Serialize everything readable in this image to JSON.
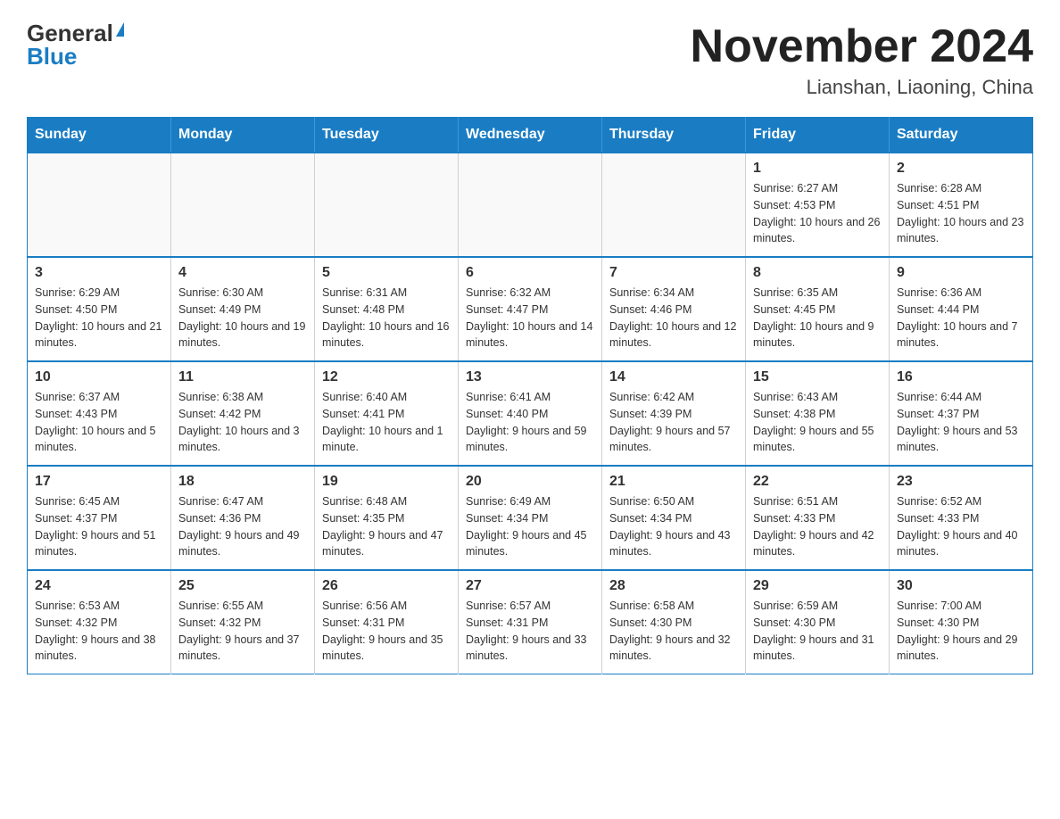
{
  "logo": {
    "general": "General",
    "blue": "Blue",
    "triangle": "▶"
  },
  "header": {
    "month_year": "November 2024",
    "location": "Lianshan, Liaoning, China"
  },
  "weekdays": [
    "Sunday",
    "Monday",
    "Tuesday",
    "Wednesday",
    "Thursday",
    "Friday",
    "Saturday"
  ],
  "weeks": [
    [
      {
        "day": "",
        "info": ""
      },
      {
        "day": "",
        "info": ""
      },
      {
        "day": "",
        "info": ""
      },
      {
        "day": "",
        "info": ""
      },
      {
        "day": "",
        "info": ""
      },
      {
        "day": "1",
        "info": "Sunrise: 6:27 AM\nSunset: 4:53 PM\nDaylight: 10 hours and 26 minutes."
      },
      {
        "day": "2",
        "info": "Sunrise: 6:28 AM\nSunset: 4:51 PM\nDaylight: 10 hours and 23 minutes."
      }
    ],
    [
      {
        "day": "3",
        "info": "Sunrise: 6:29 AM\nSunset: 4:50 PM\nDaylight: 10 hours and 21 minutes."
      },
      {
        "day": "4",
        "info": "Sunrise: 6:30 AM\nSunset: 4:49 PM\nDaylight: 10 hours and 19 minutes."
      },
      {
        "day": "5",
        "info": "Sunrise: 6:31 AM\nSunset: 4:48 PM\nDaylight: 10 hours and 16 minutes."
      },
      {
        "day": "6",
        "info": "Sunrise: 6:32 AM\nSunset: 4:47 PM\nDaylight: 10 hours and 14 minutes."
      },
      {
        "day": "7",
        "info": "Sunrise: 6:34 AM\nSunset: 4:46 PM\nDaylight: 10 hours and 12 minutes."
      },
      {
        "day": "8",
        "info": "Sunrise: 6:35 AM\nSunset: 4:45 PM\nDaylight: 10 hours and 9 minutes."
      },
      {
        "day": "9",
        "info": "Sunrise: 6:36 AM\nSunset: 4:44 PM\nDaylight: 10 hours and 7 minutes."
      }
    ],
    [
      {
        "day": "10",
        "info": "Sunrise: 6:37 AM\nSunset: 4:43 PM\nDaylight: 10 hours and 5 minutes."
      },
      {
        "day": "11",
        "info": "Sunrise: 6:38 AM\nSunset: 4:42 PM\nDaylight: 10 hours and 3 minutes."
      },
      {
        "day": "12",
        "info": "Sunrise: 6:40 AM\nSunset: 4:41 PM\nDaylight: 10 hours and 1 minute."
      },
      {
        "day": "13",
        "info": "Sunrise: 6:41 AM\nSunset: 4:40 PM\nDaylight: 9 hours and 59 minutes."
      },
      {
        "day": "14",
        "info": "Sunrise: 6:42 AM\nSunset: 4:39 PM\nDaylight: 9 hours and 57 minutes."
      },
      {
        "day": "15",
        "info": "Sunrise: 6:43 AM\nSunset: 4:38 PM\nDaylight: 9 hours and 55 minutes."
      },
      {
        "day": "16",
        "info": "Sunrise: 6:44 AM\nSunset: 4:37 PM\nDaylight: 9 hours and 53 minutes."
      }
    ],
    [
      {
        "day": "17",
        "info": "Sunrise: 6:45 AM\nSunset: 4:37 PM\nDaylight: 9 hours and 51 minutes."
      },
      {
        "day": "18",
        "info": "Sunrise: 6:47 AM\nSunset: 4:36 PM\nDaylight: 9 hours and 49 minutes."
      },
      {
        "day": "19",
        "info": "Sunrise: 6:48 AM\nSunset: 4:35 PM\nDaylight: 9 hours and 47 minutes."
      },
      {
        "day": "20",
        "info": "Sunrise: 6:49 AM\nSunset: 4:34 PM\nDaylight: 9 hours and 45 minutes."
      },
      {
        "day": "21",
        "info": "Sunrise: 6:50 AM\nSunset: 4:34 PM\nDaylight: 9 hours and 43 minutes."
      },
      {
        "day": "22",
        "info": "Sunrise: 6:51 AM\nSunset: 4:33 PM\nDaylight: 9 hours and 42 minutes."
      },
      {
        "day": "23",
        "info": "Sunrise: 6:52 AM\nSunset: 4:33 PM\nDaylight: 9 hours and 40 minutes."
      }
    ],
    [
      {
        "day": "24",
        "info": "Sunrise: 6:53 AM\nSunset: 4:32 PM\nDaylight: 9 hours and 38 minutes."
      },
      {
        "day": "25",
        "info": "Sunrise: 6:55 AM\nSunset: 4:32 PM\nDaylight: 9 hours and 37 minutes."
      },
      {
        "day": "26",
        "info": "Sunrise: 6:56 AM\nSunset: 4:31 PM\nDaylight: 9 hours and 35 minutes."
      },
      {
        "day": "27",
        "info": "Sunrise: 6:57 AM\nSunset: 4:31 PM\nDaylight: 9 hours and 33 minutes."
      },
      {
        "day": "28",
        "info": "Sunrise: 6:58 AM\nSunset: 4:30 PM\nDaylight: 9 hours and 32 minutes."
      },
      {
        "day": "29",
        "info": "Sunrise: 6:59 AM\nSunset: 4:30 PM\nDaylight: 9 hours and 31 minutes."
      },
      {
        "day": "30",
        "info": "Sunrise: 7:00 AM\nSunset: 4:30 PM\nDaylight: 9 hours and 29 minutes."
      }
    ]
  ]
}
